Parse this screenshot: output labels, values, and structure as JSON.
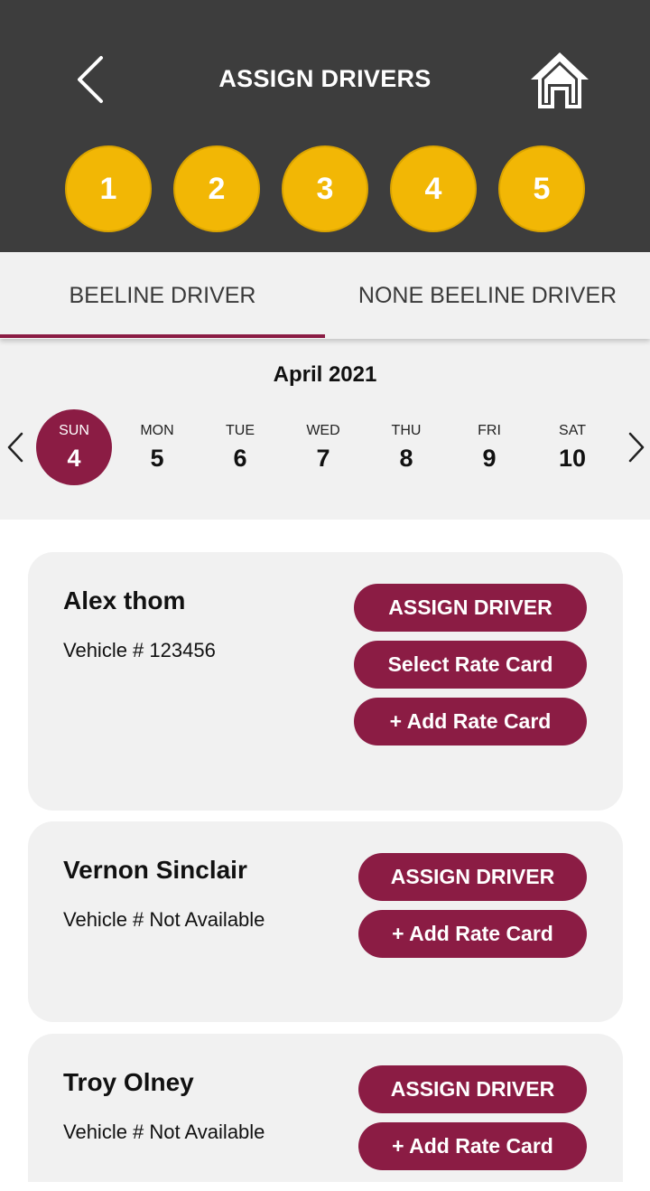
{
  "header": {
    "title": "ASSIGN DRIVERS",
    "back_icon": "chevron-left-icon",
    "home_icon": "home-icon",
    "steps": [
      "1",
      "2",
      "3",
      "4",
      "5"
    ],
    "step_color": "#f2b705",
    "background": "#3d3d3d"
  },
  "tabs": {
    "items": [
      "BEELINE DRIVER",
      "NONE BEELINE DRIVER"
    ],
    "active_index": 0,
    "accent": "#8b1c44"
  },
  "calendar": {
    "month": "April 2021",
    "prev_icon": "chevron-left-icon",
    "next_icon": "chevron-right-icon",
    "days": [
      {
        "name": "SUN",
        "num": "4"
      },
      {
        "name": "MON",
        "num": "5"
      },
      {
        "name": "TUE",
        "num": "6"
      },
      {
        "name": "WED",
        "num": "7"
      },
      {
        "name": "THU",
        "num": "8"
      },
      {
        "name": "FRI",
        "num": "9"
      },
      {
        "name": "SAT",
        "num": "10"
      }
    ],
    "selected_index": 0
  },
  "drivers": [
    {
      "name": "Alex thom",
      "vehicle": "Vehicle # 123456",
      "buttons": [
        "ASSIGN DRIVER",
        "Select Rate Card",
        "+ Add Rate Card"
      ]
    },
    {
      "name": "Vernon Sinclair",
      "vehicle": "Vehicle # Not Available",
      "buttons": [
        "ASSIGN DRIVER",
        "+ Add Rate Card"
      ]
    },
    {
      "name": "Troy Olney",
      "vehicle": "Vehicle # Not Available",
      "buttons": [
        "ASSIGN DRIVER",
        "+ Add Rate Card"
      ]
    }
  ],
  "colors": {
    "button": "#8b1c44",
    "card": "#f1f1f1"
  }
}
